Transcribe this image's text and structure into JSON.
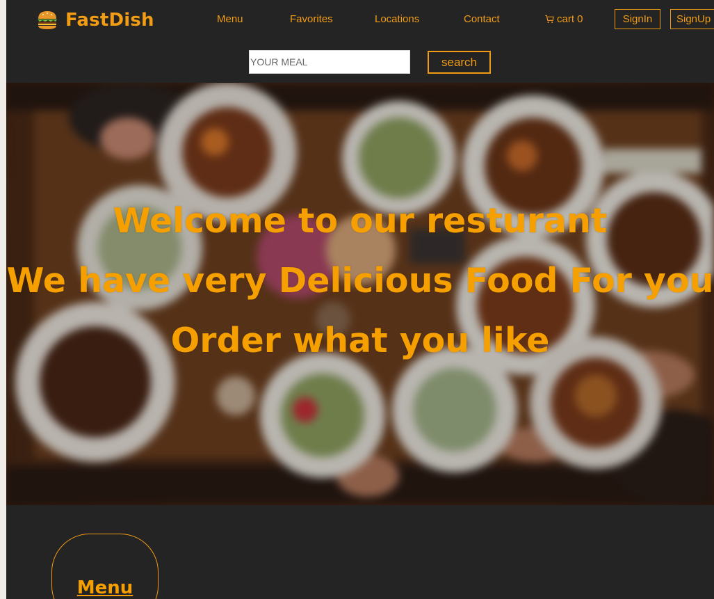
{
  "brand": {
    "name": "FastDish",
    "logo_icon": "burger-icon"
  },
  "nav": {
    "links": [
      {
        "id": "menu",
        "label": "Menu"
      },
      {
        "id": "favorites",
        "label": "Favorites"
      },
      {
        "id": "locations",
        "label": "Locations"
      },
      {
        "id": "contact",
        "label": "Contact"
      }
    ],
    "cart": {
      "label": "cart 0",
      "icon": "cart-icon"
    },
    "signin_label": "SignIn",
    "signup_label": "SignUp"
  },
  "search": {
    "placeholder": "YOUR MEAL",
    "value": "",
    "button_label": "search"
  },
  "hero": {
    "line1": "Welcome to our resturant",
    "line2": "We have very Delicious Food For you",
    "line3": "Order what you like"
  },
  "sections": {
    "menu_title": "Menu"
  },
  "colors": {
    "accent": "#f29c14",
    "background": "#242424",
    "hero_text": "#f5a000"
  }
}
